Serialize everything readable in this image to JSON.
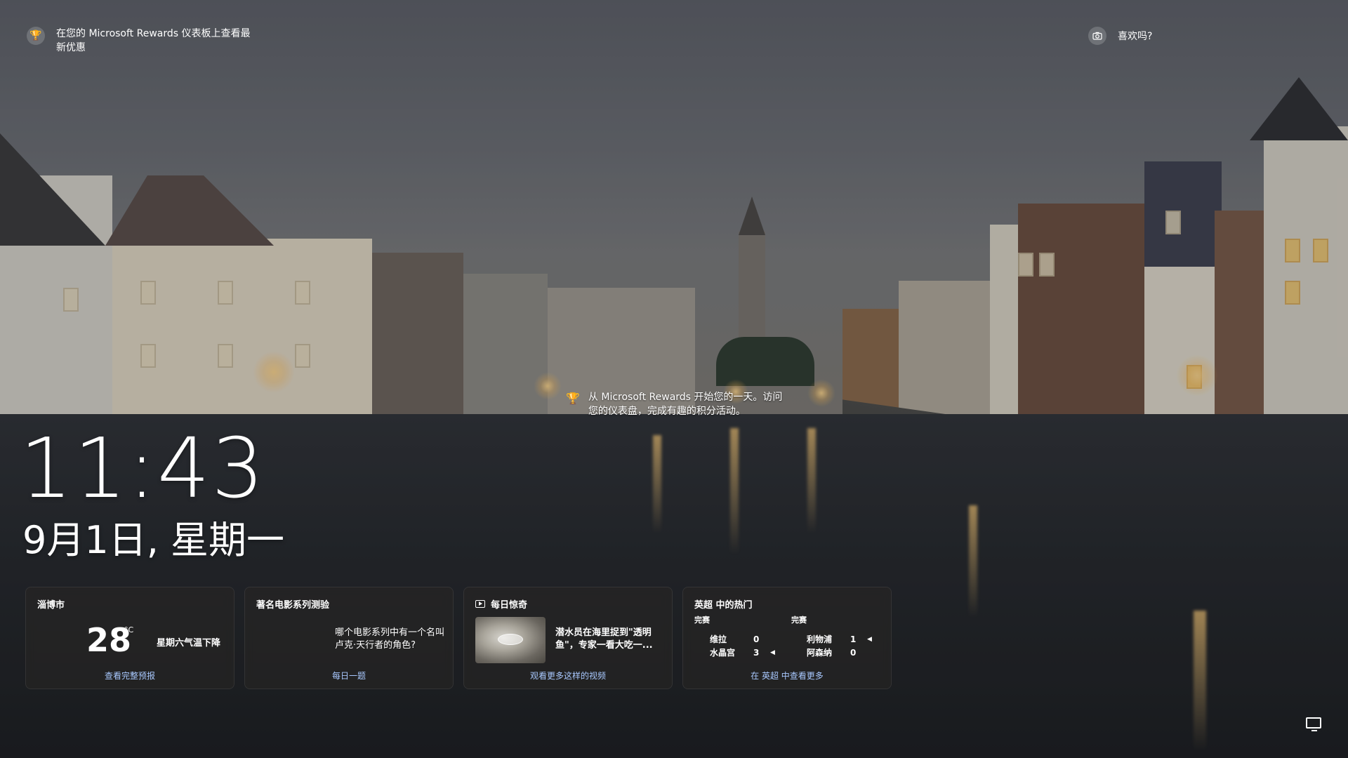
{
  "rewards_top": {
    "icon": "trophy-icon",
    "text": "在您的 Microsoft Rewards 仪表板上查看最新优惠"
  },
  "like": {
    "icon": "camera-icon",
    "label": "喜欢吗?"
  },
  "rewards_mid": {
    "icon": "trophy-icon",
    "text": "从 Microsoft Rewards 开始您的一天。访问您的仪表盘，完成有趣的积分活动。"
  },
  "clock": {
    "time": "11:43",
    "date": "9月1日, 星期一"
  },
  "cards": {
    "weather": {
      "title": "淄博市",
      "temp": "28",
      "unit": "°C",
      "desc": "星期六气温下降",
      "link": "查看完整预报"
    },
    "quiz": {
      "title": "著名电影系列测验",
      "text": "哪个电影系列中有一个名叫卢克·天行者的角色?",
      "link": "每日一题"
    },
    "video": {
      "icon": "video-icon",
      "title": "每日惊奇",
      "text": "潜水员在海里捉到\"透明鱼\"，专家一看大吃一...",
      "link": "观看更多这样的视频"
    },
    "sports": {
      "title": "英超 中的热门",
      "matches": [
        {
          "status": "完赛",
          "teams": [
            {
              "name": "维拉",
              "score": "0",
              "winner": false
            },
            {
              "name": "水晶宫",
              "score": "3",
              "winner": true
            }
          ]
        },
        {
          "status": "完赛",
          "teams": [
            {
              "name": "利物浦",
              "score": "1",
              "winner": true
            },
            {
              "name": "阿森纳",
              "score": "0",
              "winner": false
            }
          ]
        }
      ],
      "link": "在 英超 中查看更多"
    }
  },
  "system": {
    "icon": "monitor-icon"
  }
}
